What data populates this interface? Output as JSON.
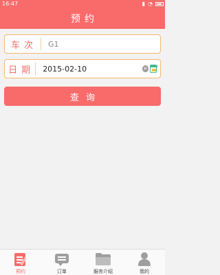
{
  "status_bar": {
    "time": "16:47",
    "icons": [
      "signal-icon",
      "wifi-icon",
      "battery-icon"
    ]
  },
  "header": {
    "title": "预约"
  },
  "form": {
    "train_number": {
      "label": "车次",
      "value": "",
      "placeholder": "G1"
    },
    "date": {
      "label": "日期",
      "value": "2015-02-10",
      "clear_icon": "clear-icon",
      "calendar_icon": "calendar-icon"
    },
    "query_button_label": "查询"
  },
  "tab_bar": {
    "active": "reserve",
    "items": [
      {
        "key": "reserve",
        "label": "预约",
        "icon": "reserve-icon"
      },
      {
        "key": "orders",
        "label": "订单",
        "icon": "orders-icon"
      },
      {
        "key": "services",
        "label": "服务介绍",
        "icon": "folder-icon"
      },
      {
        "key": "mine",
        "label": "我的",
        "icon": "user-icon"
      }
    ]
  },
  "colors": {
    "primary": "#f86b6a",
    "field_border": "#f5b86a",
    "background": "#f2f2f2",
    "inactive_icon": "#9e9e9e"
  }
}
